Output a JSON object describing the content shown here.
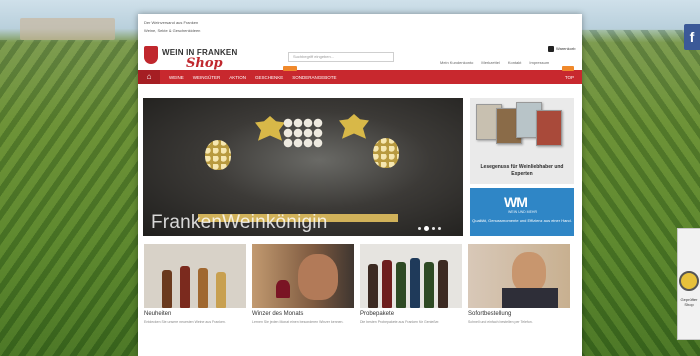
{
  "page": {
    "top_line_1": "Der Weinversand aus Franken",
    "top_line_2": "Weine, Sekte & Geschenkideen"
  },
  "header": {
    "logo_line_1": "WEIN IN FRANKEN",
    "logo_line_2": "Shop",
    "search_placeholder": "Suchbegriff eingeben...",
    "cart_label": "Warenkorb",
    "top_links": [
      "Mein Kundenkonto",
      "Merkzettel",
      "Kontakt",
      "Impressum"
    ]
  },
  "nav": {
    "home_icon": "home-icon",
    "items": [
      "WEINE",
      "WEINGÜTER",
      "AKTION",
      "GESCHENKE",
      "SONDERANGEBOTE"
    ],
    "right_item": "TOP",
    "badge_color": "#f0892b",
    "bar_color": "#c8282e"
  },
  "hero": {
    "caption": "FrankenWeinkönigin",
    "active_dot": 1
  },
  "ads": {
    "magazine_caption": "Lesegenuss für Weinliebhaber und Experten",
    "wm_title": "WM",
    "wm_subtitle": "WEIN UND MEHR",
    "wm_text": "Qualität, Genussmomente und Effizienz aus einer Hand."
  },
  "tiles": [
    {
      "title": "Neuheiten",
      "desc": "Entdecken Sie unsere neuesten Weine aus Franken."
    },
    {
      "title": "Winzer des Monats",
      "desc": "Lernen Sie jeden Monat einen besonderen Winzer kennen."
    },
    {
      "title": "Probepakete",
      "desc": "Die besten Probepakete aus Franken für Genießer."
    },
    {
      "title": "Sofortbestellung",
      "desc": "Schnell und einfach bestellen per Telefon."
    }
  ],
  "side": {
    "facebook_label": "f",
    "trust_label": "Geprüfter Shop"
  }
}
